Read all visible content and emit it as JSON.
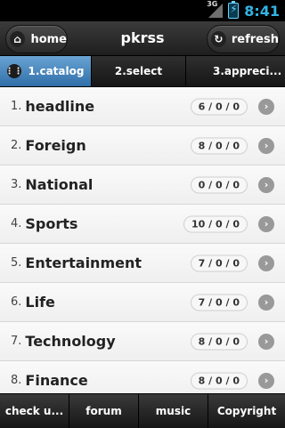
{
  "status": {
    "network": "3G",
    "time": "8:41"
  },
  "header": {
    "title": "pkrss",
    "home_label": "home",
    "refresh_label": "refresh",
    "home_icon": "home-icon",
    "refresh_icon": "refresh-icon"
  },
  "tabs": [
    {
      "label": "1.catalog"
    },
    {
      "label": "2.select"
    },
    {
      "label": "3.appreci..."
    }
  ],
  "list": {
    "items": [
      {
        "num": "1.",
        "label": "headline",
        "count": "6 / 0 / 0"
      },
      {
        "num": "2.",
        "label": "Foreign",
        "count": "8 / 0 / 0"
      },
      {
        "num": "3.",
        "label": "National",
        "count": "0 / 0 / 0"
      },
      {
        "num": "4.",
        "label": "Sports",
        "count": "10 / 0 / 0"
      },
      {
        "num": "5.",
        "label": "Entertainment",
        "count": "7 / 0 / 0"
      },
      {
        "num": "6.",
        "label": "Life",
        "count": "7 / 0 / 0"
      },
      {
        "num": "7.",
        "label": "Technology",
        "count": "8 / 0 / 0"
      },
      {
        "num": "8.",
        "label": "Finance",
        "count": "8 / 0 / 0"
      }
    ]
  },
  "footer": [
    {
      "label": "check u..."
    },
    {
      "label": "forum"
    },
    {
      "label": "music"
    },
    {
      "label": "Copyright"
    }
  ],
  "colors": {
    "accent": "#33b5e5",
    "active_tab": "#4a89c2"
  }
}
